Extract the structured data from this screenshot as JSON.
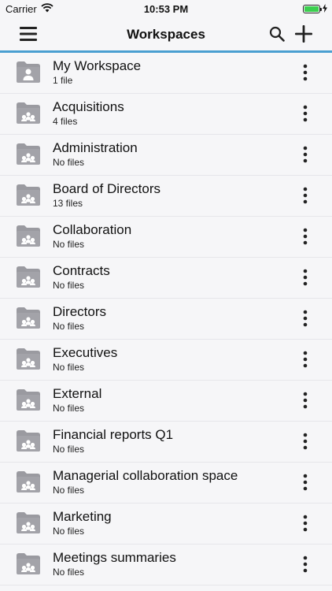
{
  "status": {
    "carrier": "Carrier",
    "time": "10:53 PM"
  },
  "nav": {
    "title": "Workspaces",
    "menu_icon": "hamburger-icon",
    "search_icon": "search-icon",
    "add_icon": "plus-icon"
  },
  "colors": {
    "accent": "#4a9fd1",
    "folder": "#9a9aa0",
    "battery": "#3bcf4f"
  },
  "workspaces": [
    {
      "name": "My Workspace",
      "count": "1 file",
      "icon": "personal-folder-icon"
    },
    {
      "name": "Acquisitions",
      "count": "4 files",
      "icon": "shared-folder-icon"
    },
    {
      "name": "Administration",
      "count": "No files",
      "icon": "shared-folder-icon"
    },
    {
      "name": "Board of Directors",
      "count": "13 files",
      "icon": "shared-folder-icon"
    },
    {
      "name": "Collaboration",
      "count": "No files",
      "icon": "shared-folder-icon"
    },
    {
      "name": "Contracts",
      "count": "No files",
      "icon": "shared-folder-icon"
    },
    {
      "name": "Directors",
      "count": "No files",
      "icon": "shared-folder-icon"
    },
    {
      "name": "Executives",
      "count": "No files",
      "icon": "shared-folder-icon"
    },
    {
      "name": "External",
      "count": "No files",
      "icon": "shared-folder-icon"
    },
    {
      "name": "Financial reports Q1",
      "count": "No files",
      "icon": "shared-folder-icon"
    },
    {
      "name": "Managerial collaboration space",
      "count": "No files",
      "icon": "shared-folder-icon"
    },
    {
      "name": "Marketing",
      "count": "No files",
      "icon": "shared-folder-icon"
    },
    {
      "name": "Meetings summaries",
      "count": "No files",
      "icon": "shared-folder-icon"
    }
  ]
}
